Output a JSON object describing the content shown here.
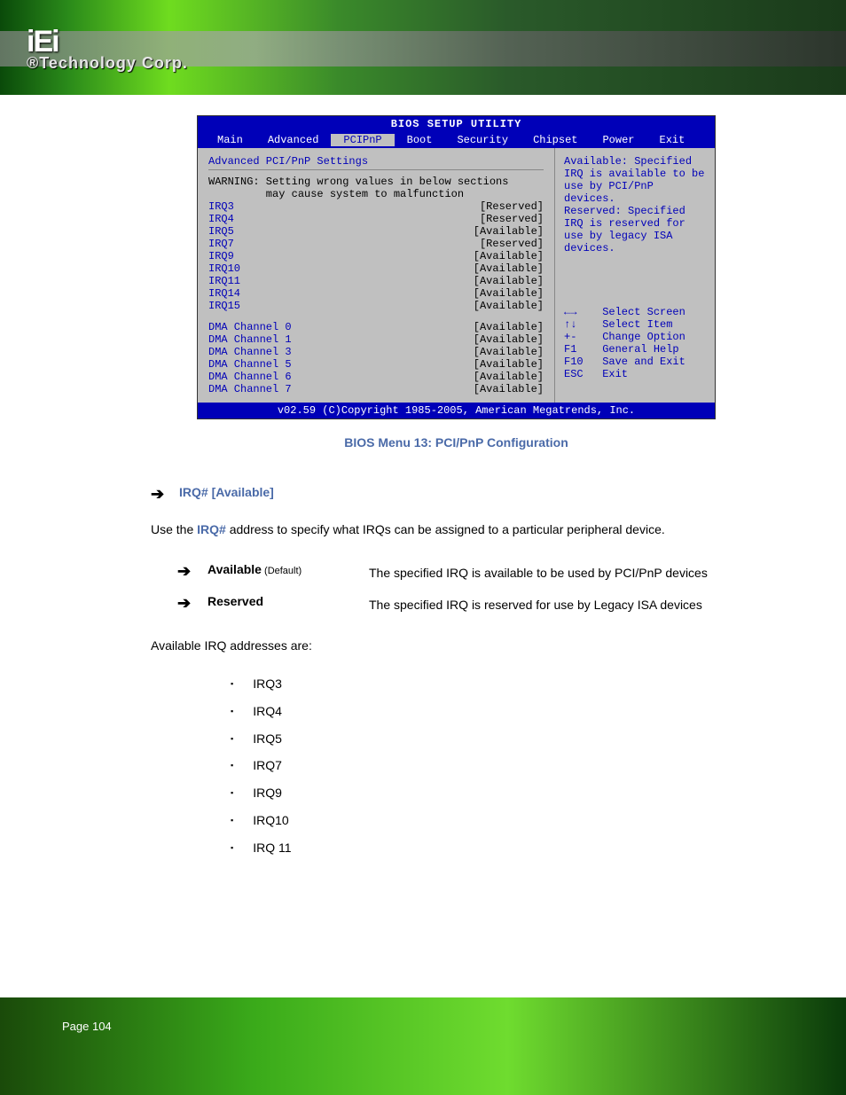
{
  "brand": {
    "logo": "iEi",
    "reg": "®",
    "tagline": "Technology Corp."
  },
  "page_number": "Page 104",
  "bios": {
    "title": "BIOS SETUP UTILITY",
    "menu": [
      "Main",
      "Advanced",
      "PCIPnP",
      "Boot",
      "Security",
      "Chipset",
      "Power",
      "Exit"
    ],
    "active_menu_index": 2,
    "section": "Advanced PCI/PnP Settings",
    "warning_l1": "WARNING: Setting wrong values in below sections",
    "warning_l2": "         may cause system to malfunction",
    "rows": [
      {
        "k": "IRQ3",
        "v": "[Reserved]"
      },
      {
        "k": "IRQ4",
        "v": "[Reserved]"
      },
      {
        "k": "IRQ5",
        "v": "[Available]"
      },
      {
        "k": "IRQ7",
        "v": "[Reserved]"
      },
      {
        "k": "IRQ9",
        "v": "[Available]"
      },
      {
        "k": "IRQ10",
        "v": "[Available]"
      },
      {
        "k": "IRQ11",
        "v": "[Available]"
      },
      {
        "k": "IRQ14",
        "v": "[Available]"
      },
      {
        "k": "IRQ15",
        "v": "[Available]"
      }
    ],
    "dma_rows": [
      {
        "k": "DMA Channel 0",
        "v": "[Available]"
      },
      {
        "k": "DMA Channel 1",
        "v": "[Available]"
      },
      {
        "k": "DMA Channel 3",
        "v": "[Available]"
      },
      {
        "k": "DMA Channel 5",
        "v": "[Available]"
      },
      {
        "k": "DMA Channel 6",
        "v": "[Available]"
      },
      {
        "k": "DMA Channel 7",
        "v": "[Available]"
      }
    ],
    "help": "Available: Specified IRQ is available to be use by PCI/PnP devices.\nReserved: Specified IRQ is reserved for use by legacy ISA devices.",
    "keys": [
      "←→    Select Screen",
      "↑↓    Select Item",
      "+-    Change Option",
      "F1    General Help",
      "F10   Save and Exit",
      "ESC   Exit"
    ],
    "footer": "v02.59 (C)Copyright 1985-2005, American Megatrends, Inc."
  },
  "caption": "BIOS Menu 13: PCI/PnP Configuration",
  "irq_heading": "IRQ# [Available]",
  "body_para_pre": "Use the ",
  "body_para_kw": "IRQ#",
  "body_para_post": " address to specify what IRQs can be assigned to a particular peripheral device.",
  "options": [
    {
      "label": "Available",
      "default": "(Default)",
      "desc": "The specified IRQ is available to be used by PCI/PnP devices"
    },
    {
      "label": "Reserved",
      "default": "",
      "desc": "The specified IRQ is reserved for use by Legacy ISA devices"
    }
  ],
  "avail_heading": "Available IRQ addresses are:",
  "irq_list": [
    "IRQ3",
    "IRQ4",
    "IRQ5",
    "IRQ7",
    "IRQ9",
    "IRQ10",
    "IRQ 11"
  ]
}
